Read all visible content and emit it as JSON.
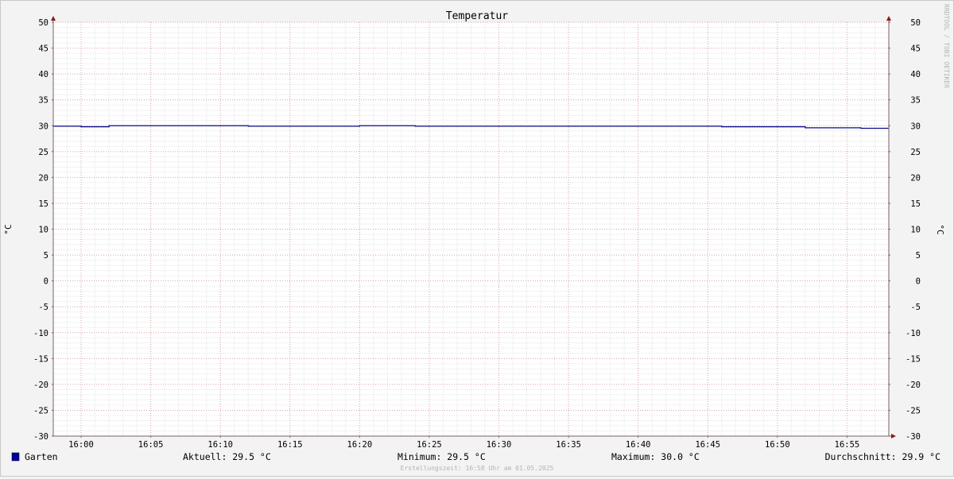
{
  "chart_data": {
    "type": "line",
    "title": "Temperatur",
    "ylabel_left": "°C",
    "ylabel_right": "°C",
    "ylim": [
      -30,
      50
    ],
    "y_ticks": [
      50,
      45,
      40,
      35,
      30,
      25,
      20,
      15,
      10,
      5,
      0,
      -5,
      -10,
      -15,
      -20,
      -25,
      -30
    ],
    "x_range": [
      "15:58",
      "16:58"
    ],
    "x_ticks": [
      "16:00",
      "16:05",
      "16:10",
      "16:15",
      "16:20",
      "16:25",
      "16:30",
      "16:35",
      "16:40",
      "16:45",
      "16:50",
      "16:55"
    ],
    "grid": true,
    "series": [
      {
        "name": "Garten",
        "color": "#0a0a8c",
        "points": [
          [
            "15:58",
            29.9
          ],
          [
            "16:00",
            29.8
          ],
          [
            "16:02",
            30.0
          ],
          [
            "16:12",
            29.9
          ],
          [
            "16:20",
            30.0
          ],
          [
            "16:24",
            29.9
          ],
          [
            "16:46",
            29.8
          ],
          [
            "16:52",
            29.6
          ],
          [
            "16:56",
            29.5
          ],
          [
            "16:58",
            29.5
          ]
        ]
      }
    ],
    "watermark": "RRDTOOL / TOBI OETIKER"
  },
  "legend": {
    "swatch_color": "#0000a0",
    "series_label": "Garten",
    "current": "Aktuell: 29.5 °C",
    "minimum": "Minimum: 29.5 °C",
    "maximum": "Maximum: 30.0 °C",
    "average": "Durchschnitt: 29.9 °C"
  },
  "footer": {
    "created": "Erstellungszeit: 16:58 Uhr am 01.05.2025"
  }
}
